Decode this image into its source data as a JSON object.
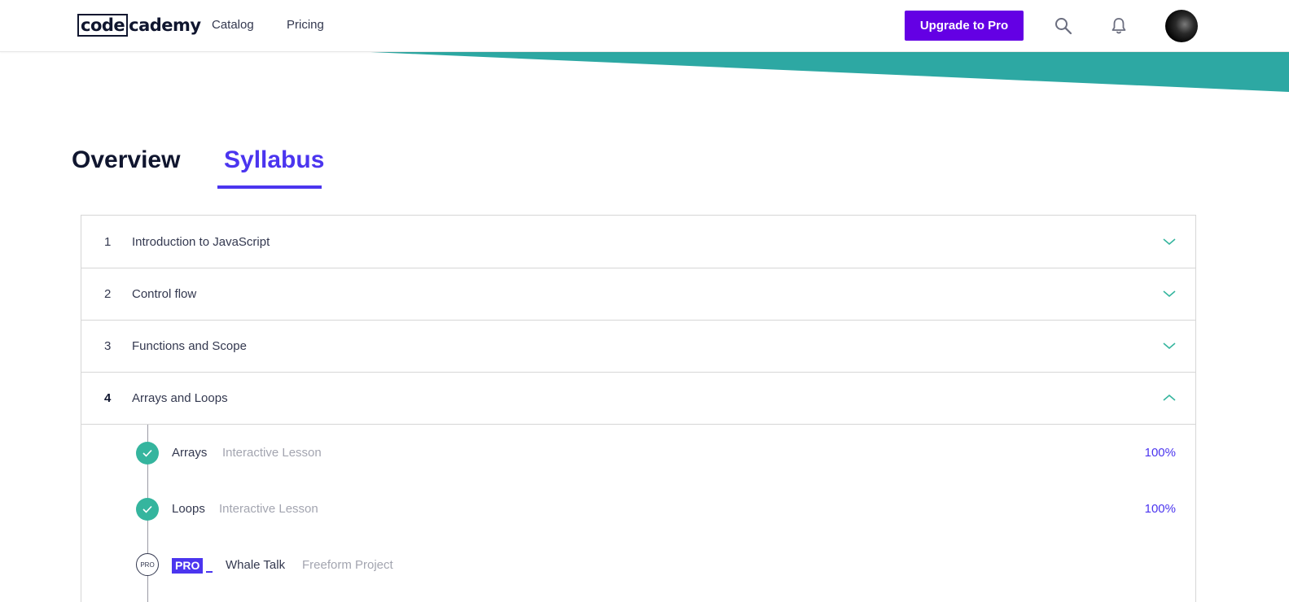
{
  "header": {
    "logo_part1": "code",
    "logo_part2": "cademy",
    "nav": [
      "Catalog",
      "Pricing"
    ],
    "upgrade_label": "Upgrade to Pro",
    "icons": [
      "search-icon",
      "bell-icon",
      "avatar"
    ]
  },
  "colors": {
    "accent_purple": "#6400e4",
    "tab_active": "#4b35ef",
    "teal": "#2da8a3",
    "check_green": "#35b59e"
  },
  "tabs": [
    {
      "label": "Overview",
      "active": false
    },
    {
      "label": "Syllabus",
      "active": true
    }
  ],
  "modules": [
    {
      "number": "1",
      "title": "Introduction to JavaScript",
      "expanded": false
    },
    {
      "number": "2",
      "title": "Control flow",
      "expanded": false
    },
    {
      "number": "3",
      "title": "Functions and Scope",
      "expanded": false
    },
    {
      "number": "4",
      "title": "Arrays and Loops",
      "expanded": true
    }
  ],
  "lessons": [
    {
      "title": "Arrays",
      "type": "Interactive Lesson",
      "progress": "100%",
      "status": "complete"
    },
    {
      "title": "Loops",
      "type": "Interactive Lesson",
      "progress": "100%",
      "status": "complete"
    },
    {
      "title": "Whale Talk",
      "type": "Freeform Project",
      "progress": "",
      "status": "pro",
      "circle_label": "PRO",
      "badge_label": "PRO"
    }
  ]
}
